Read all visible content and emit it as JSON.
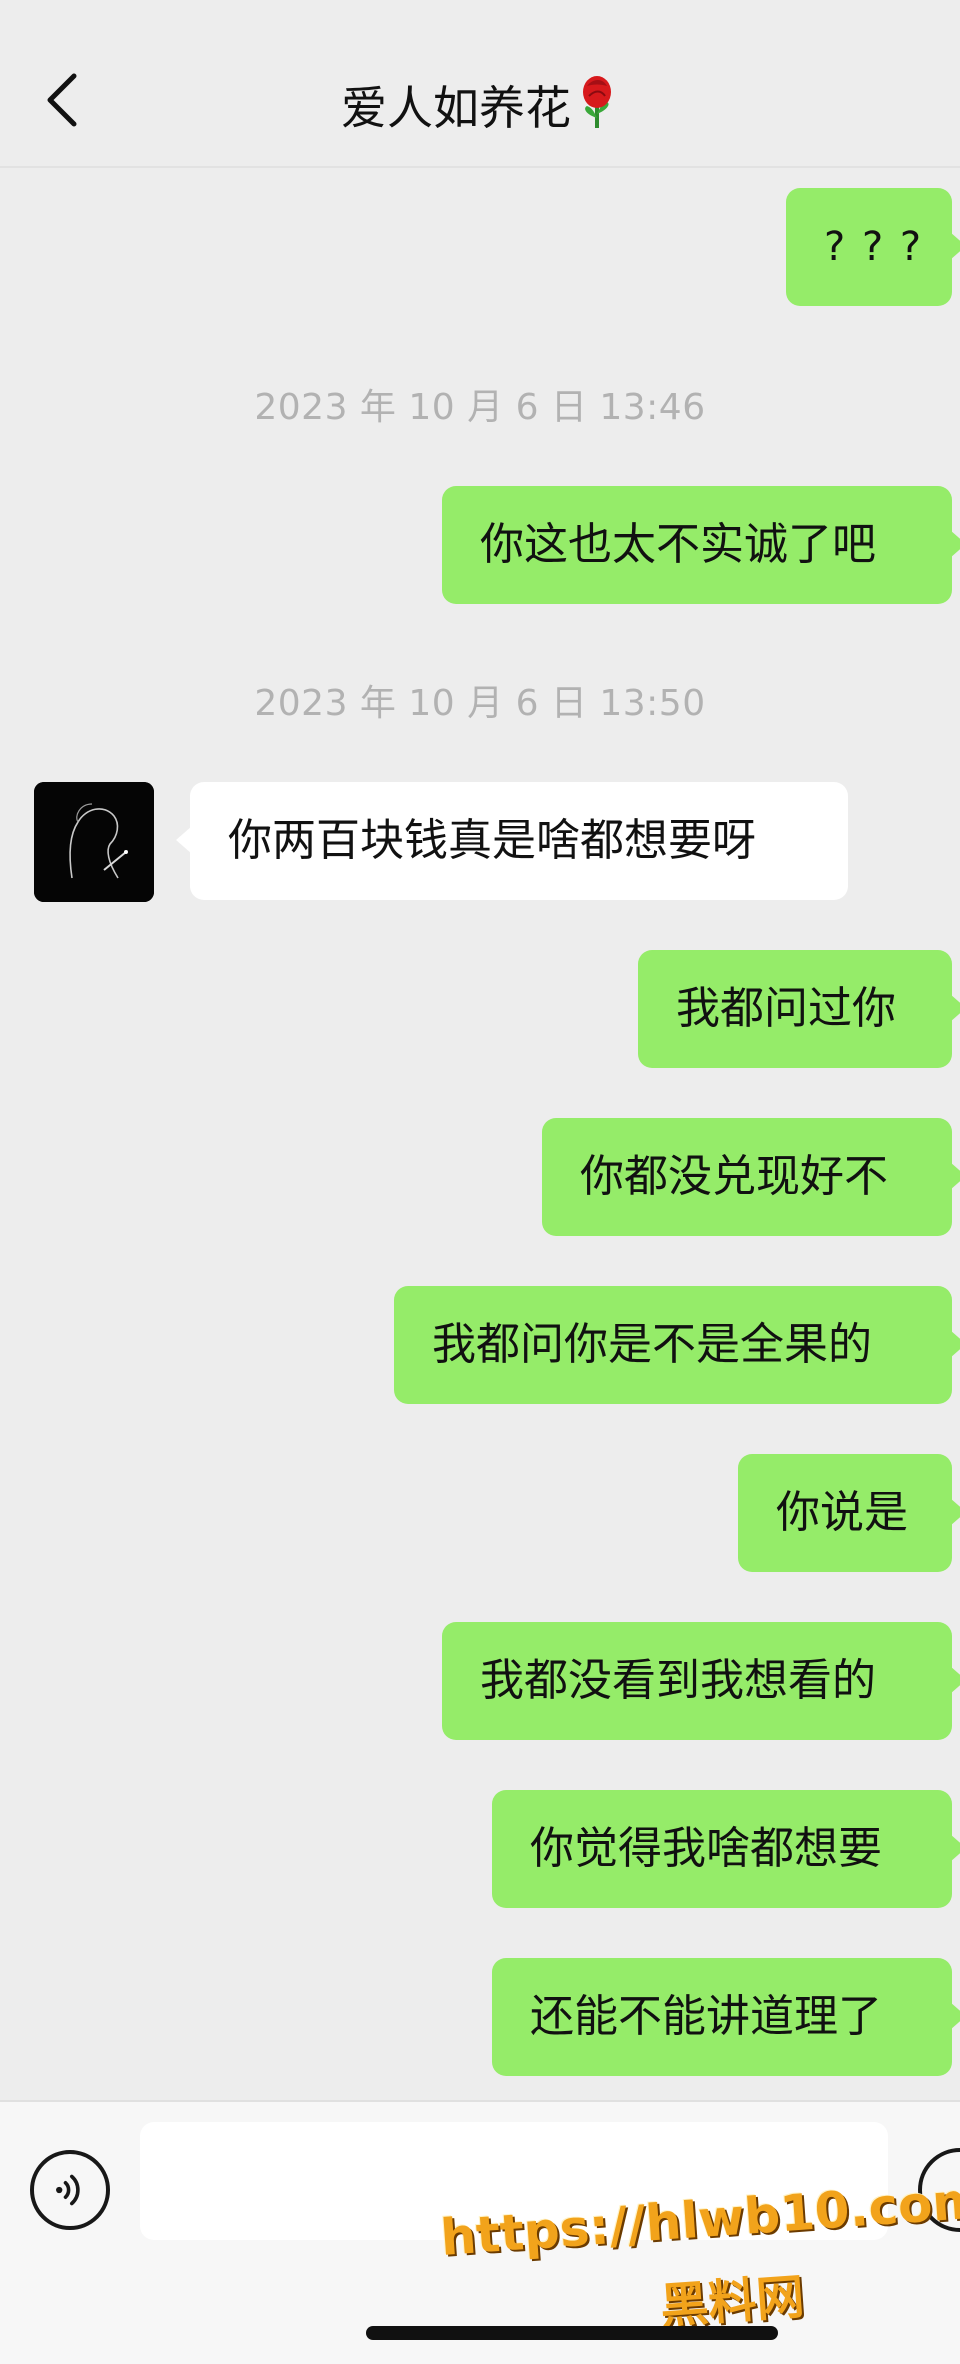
{
  "header": {
    "title": "爱人如养花",
    "title_emoji": "🌹"
  },
  "messages": [
    {
      "from": "me",
      "text": "? ? ?"
    },
    {
      "type": "time",
      "text": "2023 年 10 月 6 日 13:46"
    },
    {
      "from": "me",
      "text": "你这也太不实诚了吧"
    },
    {
      "type": "time",
      "text": "2023 年 10 月 6 日 13:50"
    },
    {
      "from": "them",
      "text": "你两百块钱真是啥都想要呀"
    },
    {
      "from": "me",
      "text": "我都问过你"
    },
    {
      "from": "me",
      "text": "你都没兑现好不"
    },
    {
      "from": "me",
      "text": "我都问你是不是全果的"
    },
    {
      "from": "me",
      "text": "你说是"
    },
    {
      "from": "me",
      "text": "我都没看到我想看的"
    },
    {
      "from": "me",
      "text": "你觉得我啥都想要"
    },
    {
      "from": "me",
      "text": "还能不能讲道理了"
    }
  ],
  "watermark": {
    "url": "https://hlwb10.com",
    "name": "黑料网"
  },
  "colors": {
    "my_bubble": "#95ec69",
    "their_bubble": "#ffffff",
    "background": "#ededed"
  }
}
